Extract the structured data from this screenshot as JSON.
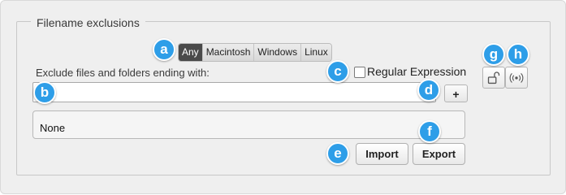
{
  "group": {
    "title": "Filename exclusions"
  },
  "platform_selector": {
    "options": [
      {
        "label": "Any",
        "active": true
      },
      {
        "label": "Macintosh",
        "active": false
      },
      {
        "label": "Windows",
        "active": false
      },
      {
        "label": "Linux",
        "active": false
      }
    ]
  },
  "exclude_label": "Exclude files and folders ending with:",
  "regex": {
    "label": "Regular Expression",
    "checked": false
  },
  "pattern_input": {
    "value": "",
    "placeholder": ""
  },
  "add_button": {
    "label": "+"
  },
  "exclusion_list": {
    "items": [
      "None"
    ]
  },
  "buttons": {
    "import_label": "Import",
    "export_label": "Export"
  },
  "side_icons": {
    "lock": "unlock-icon",
    "broadcast": "broadcast-icon"
  },
  "callouts": {
    "a": "a",
    "b": "b",
    "c": "c",
    "d": "d",
    "e": "e",
    "f": "f",
    "g": "g",
    "h": "h"
  },
  "colors": {
    "callout": "#2e9ee8",
    "active_segment": "#4a4a4a"
  }
}
